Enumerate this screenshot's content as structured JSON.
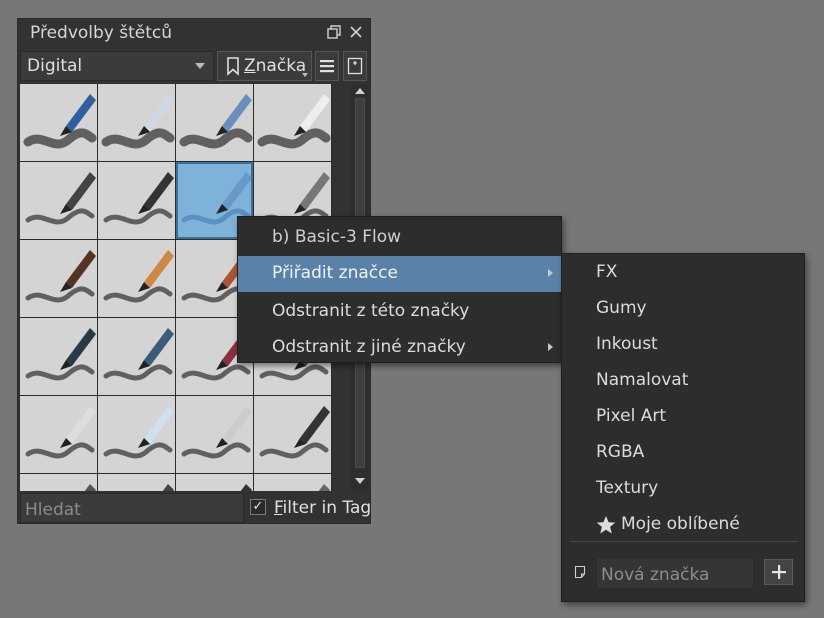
{
  "docker": {
    "title": "Předvolby štětců",
    "resource_combo": "Digital",
    "tag_button": "Značka",
    "search_placeholder": "Hledat",
    "filter_in_tag": {
      "label": "Filter in Tag",
      "checked": true
    }
  },
  "brush_grid": {
    "rows": 6,
    "columns": 4,
    "selected": "b) Basic-3 Flow"
  },
  "context_menu": {
    "items": [
      {
        "label": "b) Basic-3 Flow",
        "enabled": false,
        "submenu": false
      },
      {
        "label": "Přiřadit značce",
        "enabled": true,
        "submenu": true,
        "highlighted": true
      },
      {
        "label": "Odstranit z této značky",
        "enabled": true,
        "submenu": false
      },
      {
        "label": "Odstranit z jiné značky",
        "enabled": true,
        "submenu": true
      }
    ]
  },
  "tag_submenu": {
    "items": [
      {
        "label": "FX"
      },
      {
        "label": "Gumy"
      },
      {
        "label": "Inkoust"
      },
      {
        "label": "Namalovat"
      },
      {
        "label": "Pixel Art"
      },
      {
        "label": "RGBA"
      },
      {
        "label": "Textury"
      },
      {
        "label": "Moje oblíbené",
        "icon": "star-icon"
      }
    ],
    "new_tag_placeholder": "Nová značka"
  },
  "colors": {
    "background": "#777777",
    "panel": "#323232",
    "highlight": "#5a82a8",
    "selected_tile": "#7fb2d9"
  }
}
